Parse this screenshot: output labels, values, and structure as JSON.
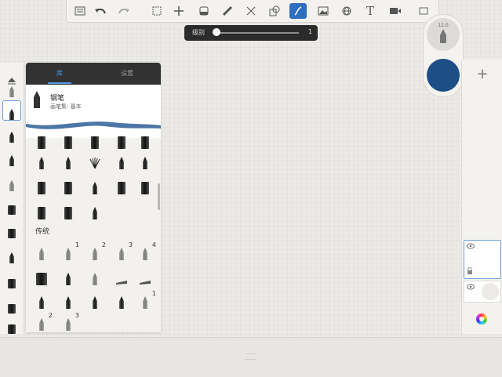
{
  "toolbar": {
    "tools": [
      "list-icon",
      "undo-icon",
      "redo-icon",
      "select-icon",
      "transform-icon",
      "layer-fill-icon",
      "ruler-icon",
      "symmetry-icon",
      "shapes-icon",
      "brush-icon",
      "image-icon",
      "perspective-icon",
      "text-icon",
      "video-icon",
      "fullscreen-icon"
    ],
    "active_tool": "brush-icon"
  },
  "slider": {
    "label": "级别",
    "value": "1"
  },
  "puck": {
    "size_label": "12.0",
    "color": "#1b4f86"
  },
  "right_panel": {
    "add_label": "+"
  },
  "brush_panel": {
    "tabs": [
      "库",
      "设置"
    ],
    "selected": {
      "name": "钢笔",
      "subtitle": "画笔集: 基本"
    },
    "section_label": "传统",
    "superscripts": [
      "1",
      "2",
      "3",
      "4",
      "1",
      "2",
      "3"
    ]
  },
  "colors": {
    "accent": "#2f6fbf",
    "tab_active": "#4d9be6",
    "panel_header": "#323232"
  }
}
